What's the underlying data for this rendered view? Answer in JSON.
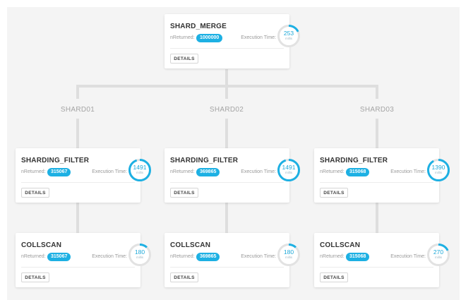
{
  "nReturned_label": "nReturned:",
  "exec_time_label": "Execution Time:",
  "details_label": "DETAILS",
  "time_unit": "millis",
  "colors": {
    "accent": "#1db0e3",
    "ring_track": "#e2e2e2",
    "connector": "#dedede"
  },
  "merge": {
    "stage": "SHARD_MERGE",
    "nReturned": "1000000",
    "exec_time": "253",
    "ring_fraction": 0.18
  },
  "shards": [
    {
      "name": "SHARD01",
      "filter": {
        "stage": "SHARDING_FILTER",
        "nReturned": "315067",
        "exec_time": "1491",
        "ring_fraction": 0.95
      },
      "scan": {
        "stage": "COLLSCAN",
        "nReturned": "315067",
        "exec_time": "180",
        "ring_fraction": 0.12
      }
    },
    {
      "name": "SHARD02",
      "filter": {
        "stage": "SHARDING_FILTER",
        "nReturned": "369865",
        "exec_time": "1491",
        "ring_fraction": 0.95
      },
      "scan": {
        "stage": "COLLSCAN",
        "nReturned": "369865",
        "exec_time": "180",
        "ring_fraction": 0.12
      }
    },
    {
      "name": "SHARD03",
      "filter": {
        "stage": "SHARDING_FILTER",
        "nReturned": "315068",
        "exec_time": "1390",
        "ring_fraction": 0.92
      },
      "scan": {
        "stage": "COLLSCAN",
        "nReturned": "315068",
        "exec_time": "270",
        "ring_fraction": 0.18
      }
    }
  ]
}
